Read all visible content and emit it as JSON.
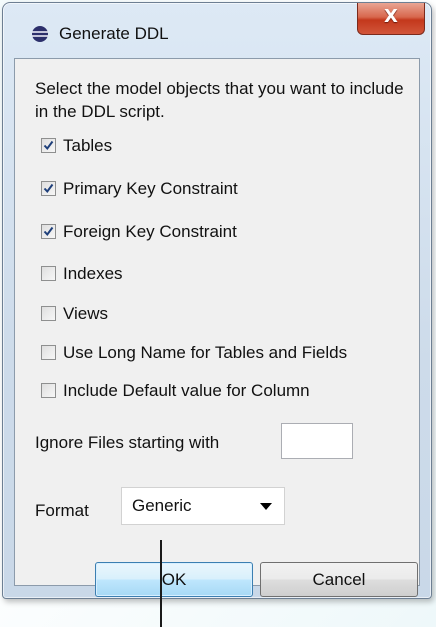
{
  "window": {
    "title": "Generate DDL",
    "close_label": "X",
    "app_icon": "eclipse-icon"
  },
  "dialog": {
    "intro": "Select the model objects that you want to include in the DDL script.",
    "options": [
      {
        "label": "Tables",
        "checked": true
      },
      {
        "label": "Primary Key Constraint",
        "checked": true
      },
      {
        "label": "Foreign Key Constraint",
        "checked": true
      },
      {
        "label": "Indexes",
        "checked": false
      },
      {
        "label": "Views",
        "checked": false
      },
      {
        "label": "Use Long Name for Tables and Fields",
        "checked": false
      },
      {
        "label": "Include Default value for Column",
        "checked": false
      }
    ],
    "ignore_label": "Ignore Files starting with",
    "ignore_value": "",
    "format_label": "Format",
    "format_value": "Generic",
    "ok_label": "OK",
    "cancel_label": "Cancel"
  },
  "colors": {
    "check_mark": "#1e3f7a",
    "ok_border": "#3c7fb1",
    "close_red": "#c3381c"
  }
}
